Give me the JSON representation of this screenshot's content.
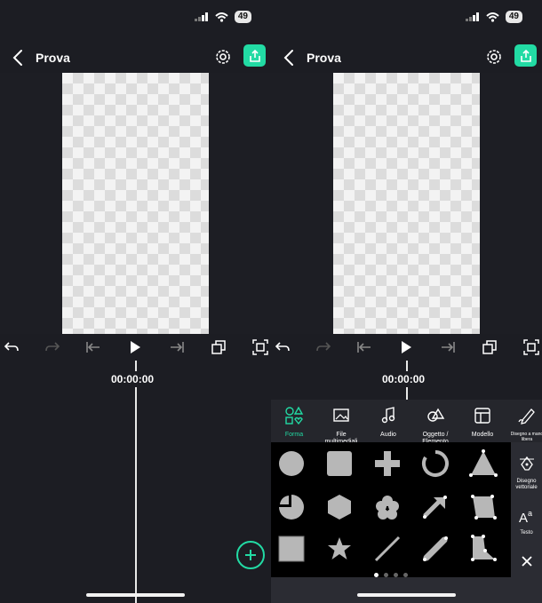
{
  "status": {
    "battery": "49"
  },
  "project": {
    "title": "Prova"
  },
  "timeline": {
    "timecode": "00:00:00"
  },
  "sheet": {
    "tabs": [
      {
        "label": "Forma",
        "icon": "shapes-icon",
        "active": true
      },
      {
        "label": "File multimediali",
        "icon": "media-icon"
      },
      {
        "label": "Audio",
        "icon": "music-note-icon"
      },
      {
        "label": "Oggetto / Elemento",
        "icon": "object-icon"
      },
      {
        "label": "Modello",
        "icon": "template-icon"
      },
      {
        "label": "Disegno a mano libera",
        "icon": "freehand-icon"
      }
    ],
    "side": [
      {
        "label": "Disegno vettoriale",
        "icon": "vector-pen-icon"
      },
      {
        "label": "Testo",
        "icon": "text-icon"
      }
    ],
    "shapes": [
      "circle",
      "square",
      "plus",
      "arc",
      "triangle",
      "pie",
      "hexagon",
      "flower",
      "arrow",
      "trapezoid",
      "square-outline",
      "star",
      "line",
      "rounded-line",
      "polygon"
    ],
    "page_dots": 4,
    "active_dot": 0
  },
  "colors": {
    "accent": "#22dba4",
    "shape": "#b7b7b7"
  }
}
